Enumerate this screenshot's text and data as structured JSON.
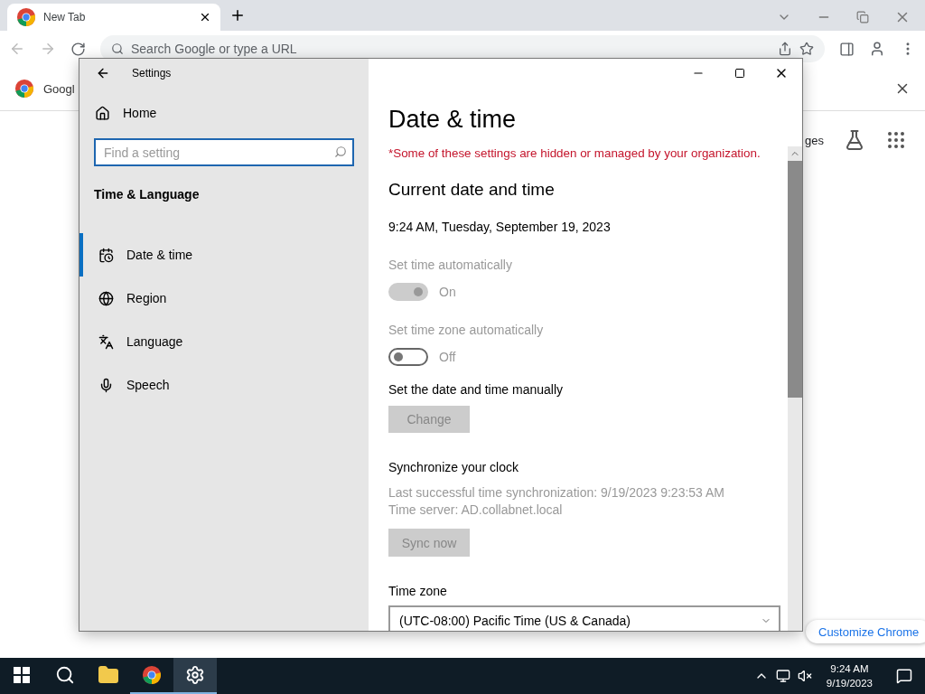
{
  "browser": {
    "tab": {
      "title": "New Tab"
    },
    "address_bar": {
      "placeholder": "Search Google or type a URL"
    },
    "bookmark": {
      "label": "Googl"
    },
    "page": {
      "link_fragment": "ges",
      "customize_button": "Customize Chrome"
    }
  },
  "settings": {
    "title": "Settings",
    "home": "Home",
    "search": {
      "placeholder": "Find a setting"
    },
    "section": "Time & Language",
    "nav_items": [
      {
        "label": "Date & time",
        "kind": "calendar",
        "selected": true
      },
      {
        "label": "Region",
        "kind": "globe",
        "selected": false
      },
      {
        "label": "Language",
        "kind": "language",
        "selected": false
      },
      {
        "label": "Speech",
        "kind": "mic",
        "selected": false
      }
    ],
    "page_title": "Date & time",
    "notice": "*Some of these settings are hidden or managed by your organization.",
    "heading": "Current date and time",
    "current": "9:24 AM, Tuesday, September 19, 2023",
    "toggles": [
      {
        "label": "Set time automatically",
        "on": true,
        "state_text": "On",
        "disabled": true
      },
      {
        "label": "Set time zone automatically",
        "on": false,
        "state_text": "Off",
        "disabled": true
      }
    ],
    "manual": {
      "label": "Set the date and time manually",
      "button": {
        "label": "Change",
        "disabled": true
      }
    },
    "sync": {
      "heading": "Synchronize your clock",
      "lines": [
        "Last successful time synchronization: 9/19/2023 9:23:53 AM",
        "Time server: AD.collabnet.local"
      ],
      "button": {
        "label": "Sync now",
        "disabled": true
      }
    },
    "time_zone": {
      "label": "Time zone",
      "value": "(UTC-08:00) Pacific Time (US & Canada)"
    }
  },
  "taskbar": {
    "apps": [
      {
        "kind": "files",
        "running": false,
        "selected": false
      },
      {
        "kind": "chrome",
        "running": true,
        "selected": false
      },
      {
        "kind": "settings",
        "running": true,
        "selected": true
      }
    ],
    "time": "9:24 AM",
    "date": "9/19/2023"
  }
}
